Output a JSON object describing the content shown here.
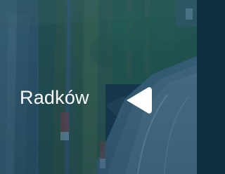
{
  "location": {
    "label": "Radków"
  },
  "arrow": {
    "icon": "left-triangle-icon",
    "direction": "left"
  },
  "background": {
    "icon": "forest-road-photo"
  },
  "colors": {
    "tint": "#1d5f82",
    "text": "#ffffff",
    "arrow": "#ffffff"
  }
}
